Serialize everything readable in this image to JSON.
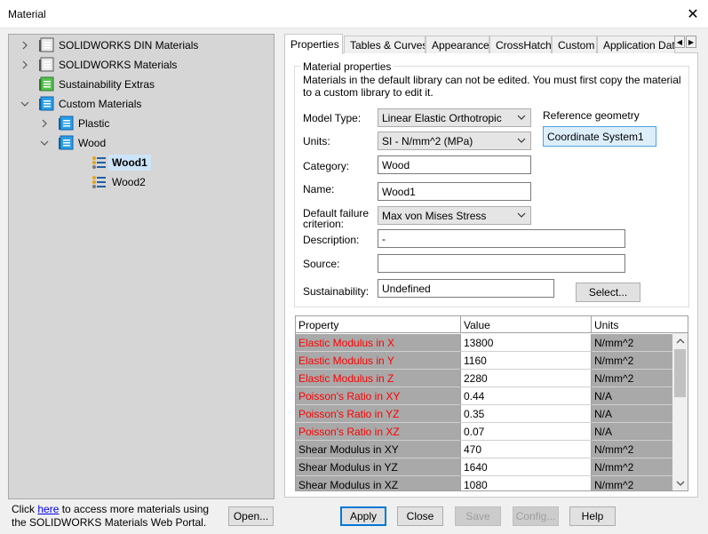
{
  "window": {
    "title": "Material"
  },
  "tree": [
    {
      "label": "SOLIDWORKS DIN Materials",
      "expander": "collapsed",
      "icon": "library-book-icon"
    },
    {
      "label": "SOLIDWORKS Materials",
      "expander": "collapsed",
      "icon": "library-book-icon"
    },
    {
      "label": "Sustainability Extras",
      "expander": "none",
      "icon": "sustainability-library-icon"
    },
    {
      "label": "Custom Materials",
      "expander": "expanded",
      "icon": "custom-library-icon"
    },
    {
      "label": "Plastic",
      "expander": "collapsed",
      "icon": "category-folder-icon"
    },
    {
      "label": "Wood",
      "expander": "expanded",
      "icon": "category-folder-icon"
    },
    {
      "label": "Wood1",
      "expander": "none",
      "icon": "material-list-icon",
      "selected": true
    },
    {
      "label": "Wood2",
      "expander": "none",
      "icon": "material-list-icon"
    }
  ],
  "footer": {
    "text_before": "Click ",
    "link": "here",
    "text_after": " to access more materials using the SOLIDWORKS Materials Web Portal.",
    "open_button": "Open..."
  },
  "tabs": [
    "Properties",
    "Tables & Curves",
    "Appearance",
    "CrossHatch",
    "Custom",
    "Application Dat"
  ],
  "active_tab": "Properties",
  "properties": {
    "group_title": "Material properties",
    "note": "Materials in the default library can not be edited. You must first copy the material to a custom library to edit it.",
    "model_type_label": "Model Type:",
    "model_type_value": "Linear Elastic Orthotropic",
    "units_label": "Units:",
    "units_value": "SI - N/mm^2 (MPa)",
    "category_label": "Category:",
    "category_value": "Wood",
    "name_label": "Name:",
    "name_value": "Wood1",
    "failure_label": "Default failure criterion:",
    "failure_value": "Max von Mises Stress",
    "description_label": "Description:",
    "description_value": "-",
    "source_label": "Source:",
    "source_value": "",
    "sustainability_label": "Sustainability:",
    "sustainability_value": "Undefined",
    "select_button": "Select...",
    "reference_geometry_label": "Reference geometry",
    "reference_geometry_value": "Coordinate System1"
  },
  "table": {
    "headers": [
      "Property",
      "Value",
      "Units"
    ],
    "rows": [
      {
        "property": "Elastic Modulus in X",
        "value": "13800",
        "units": "N/mm^2",
        "required": true
      },
      {
        "property": "Elastic Modulus in Y",
        "value": "1160",
        "units": "N/mm^2",
        "required": true
      },
      {
        "property": "Elastic Modulus in Z",
        "value": "2280",
        "units": "N/mm^2",
        "required": true
      },
      {
        "property": "Poisson's Ratio in XY",
        "value": "0.44",
        "units": "N/A",
        "required": true
      },
      {
        "property": "Poisson's Ratio in YZ",
        "value": "0.35",
        "units": "N/A",
        "required": true
      },
      {
        "property": "Poisson's Ratio in XZ",
        "value": "0.07",
        "units": "N/A",
        "required": true
      },
      {
        "property": "Shear Modulus in XY",
        "value": "470",
        "units": "N/mm^2",
        "required": false
      },
      {
        "property": "Shear Modulus in YZ",
        "value": "1640",
        "units": "N/mm^2",
        "required": false
      },
      {
        "property": "Shear Modulus in XZ",
        "value": "1080",
        "units": "N/mm^2",
        "required": false
      }
    ]
  },
  "buttons": {
    "apply": "Apply",
    "close": "Close",
    "save": "Save",
    "config": "Config...",
    "help": "Help"
  },
  "colors": {
    "required_text": "#ff0000",
    "selection": "#cce4f7",
    "accent": "#0078d7"
  }
}
